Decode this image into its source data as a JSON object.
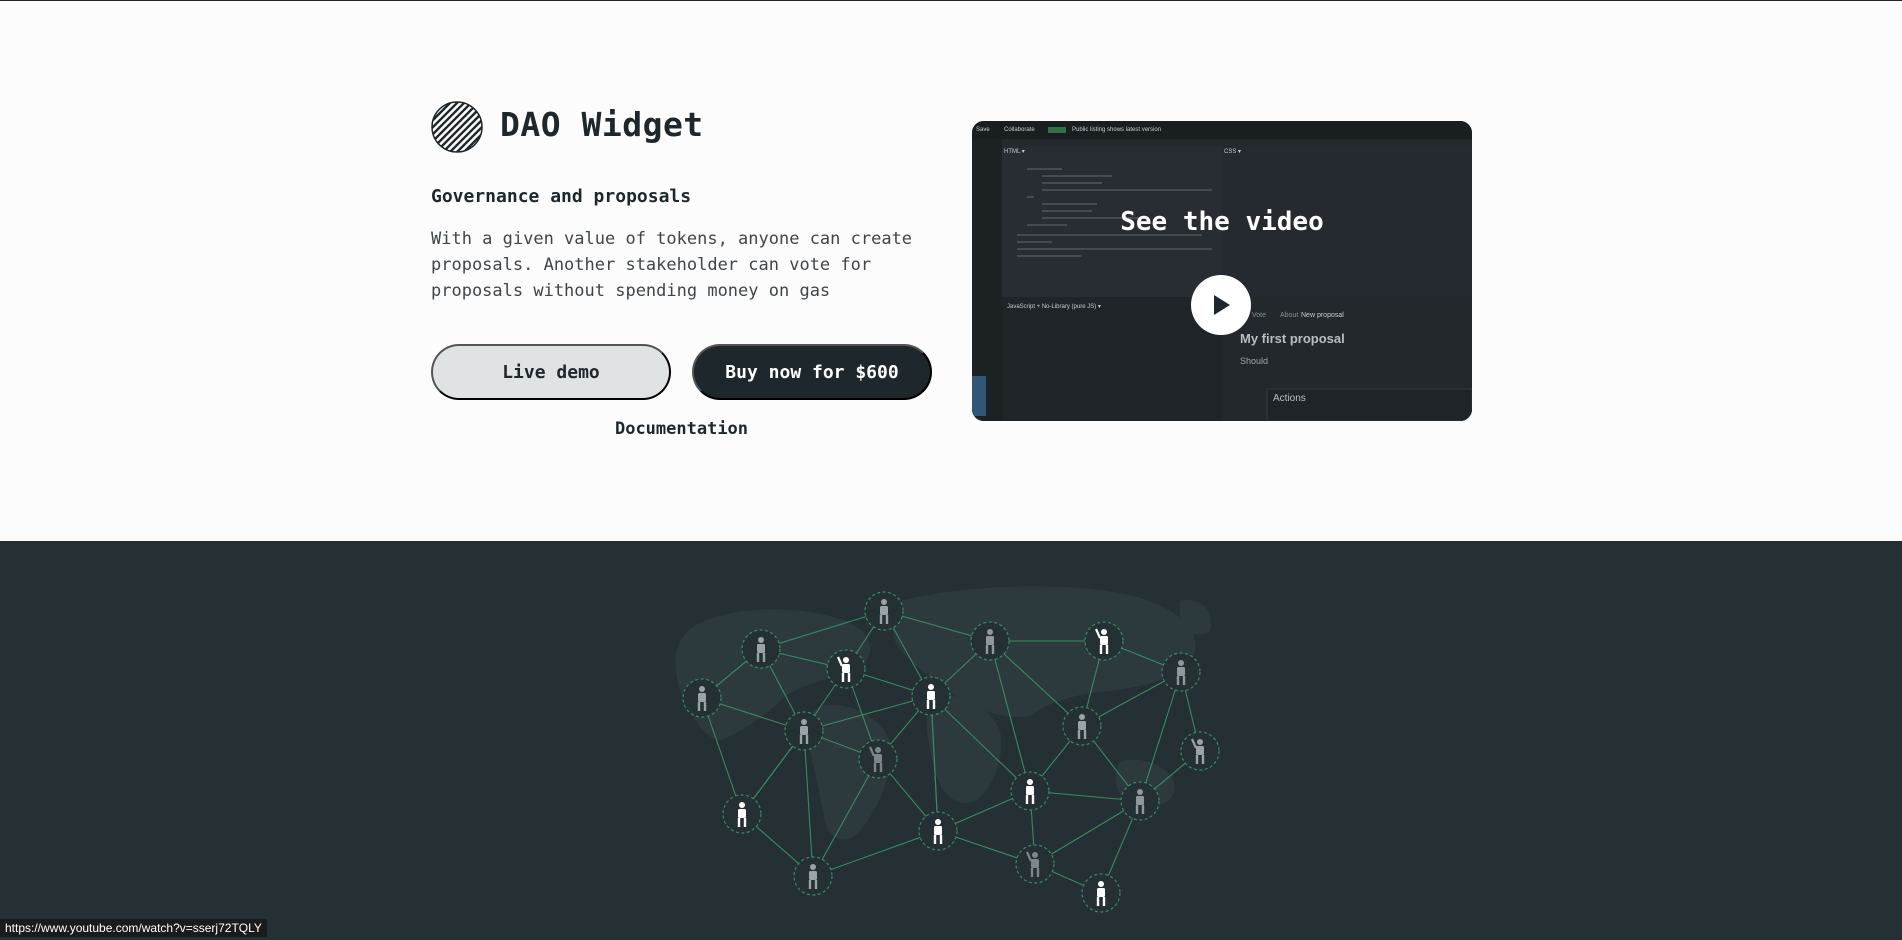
{
  "product": {
    "title": "DAO Widget",
    "subtitle": "Governance and proposals",
    "description_lines": [
      "With a given value of tokens, anyone can create",
      "proposals. Another stakeholder can vote for",
      "proposals without spending money on gas"
    ]
  },
  "actions": {
    "live_demo_label": "Live demo",
    "buy_label": "Buy now for $600",
    "documentation_label": "Documentation"
  },
  "video": {
    "overlay_title": "See the video",
    "preview": {
      "toolbar_items": [
        "Save",
        "Collaborate",
        "Public listing shows latest version"
      ],
      "html_label": "HTML ▾",
      "css_label": "CSS ▾",
      "js_label": "JavaScript + No-Library (pure JS) ▾",
      "proposal_tabs": [
        "Vote",
        "About",
        "New proposal"
      ],
      "proposal_title": "My first proposal",
      "proposal_should": "Should",
      "actions_label": "Actions"
    }
  },
  "network": {
    "icon": "people-network-world-map"
  },
  "status_bar": {
    "url": "https://www.youtube.com/watch?v=sserj72TQLY"
  },
  "colors": {
    "dark": "#1e272b",
    "network_bg": "#243033",
    "accent_green": "#3a8a64",
    "light_button": "#e0e3e4"
  }
}
